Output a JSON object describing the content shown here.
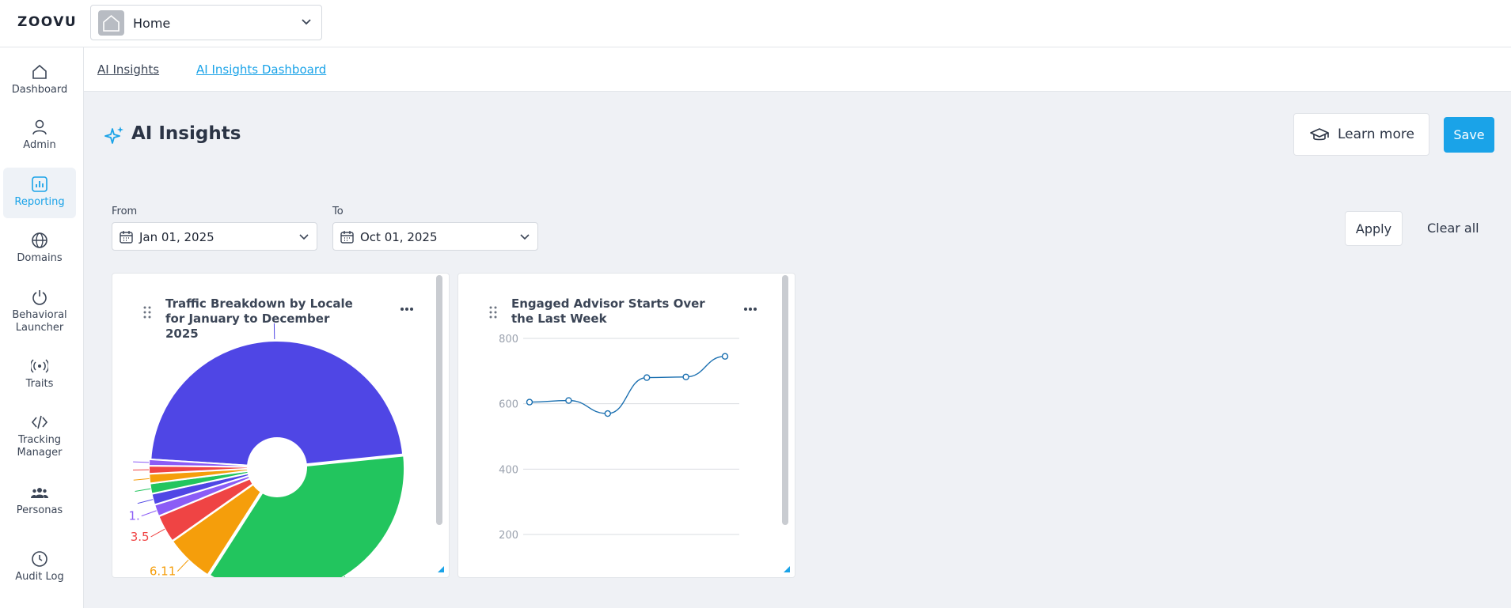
{
  "app": {
    "logo": "ZOOVU",
    "workspace": "Home"
  },
  "sidebar": {
    "items": [
      {
        "label": "Dashboard",
        "icon": "home-icon"
      },
      {
        "label": "Admin",
        "icon": "user-icon"
      },
      {
        "label": "Reporting",
        "icon": "bar-chart-icon",
        "active": true
      },
      {
        "label": "Domains",
        "icon": "globe-icon"
      },
      {
        "label": "Behavioral Launcher",
        "icon": "power-icon"
      },
      {
        "label": "Traits",
        "icon": "broadcast-icon"
      },
      {
        "label": "Tracking Manager",
        "icon": "code-icon"
      },
      {
        "label": "Personas",
        "icon": "people-icon"
      },
      {
        "label": "Audit Log",
        "icon": "clock-icon"
      }
    ]
  },
  "breadcrumb": [
    "AI Insights",
    "AI Insights Dashboard"
  ],
  "page": {
    "title": "AI Insights",
    "learn_more": "Learn more",
    "save": "Save"
  },
  "filters": {
    "from_label": "From",
    "from_value": "Jan 01, 2025",
    "to_label": "To",
    "to_value": "Oct 01, 2025",
    "apply": "Apply",
    "clear_all": "Clear all"
  },
  "colors": {
    "accent": "#1aa3e8",
    "purple": "#4f46e5",
    "green": "#22c55e",
    "orange": "#f59e0b",
    "red": "#ef4444",
    "violet": "#8b5cf6"
  },
  "chart_data": [
    {
      "type": "pie",
      "title": "Traffic Breakdown by Locale for January to December 2025",
      "slices": [
        {
          "value": 47.0,
          "color": "#4f46e5"
        },
        {
          "value": 35.41,
          "label": "35.41",
          "color": "#22c55e"
        },
        {
          "value": 6.11,
          "label": "6.11",
          "color": "#f59e0b"
        },
        {
          "value": 3.5,
          "label": "3.5",
          "color": "#ef4444"
        },
        {
          "value": 1.5,
          "label": "1.",
          "color": "#8b5cf6"
        },
        {
          "value": 1.4,
          "color": "#4f46e5"
        },
        {
          "value": 1.3,
          "color": "#22c55e"
        },
        {
          "value": 1.2,
          "color": "#f59e0b"
        },
        {
          "value": 1.0,
          "color": "#ef4444"
        },
        {
          "value": 0.8,
          "color": "#8b5cf6"
        }
      ]
    },
    {
      "type": "line",
      "title": "Engaged Advisor Starts Over the Last Week",
      "x": [
        1,
        2,
        3,
        4,
        5,
        6
      ],
      "values": [
        605,
        610,
        570,
        680,
        682,
        745
      ],
      "yticks": [
        200,
        400,
        600,
        800
      ],
      "ylim": [
        200,
        800
      ],
      "color": "#1a6fb0"
    }
  ]
}
